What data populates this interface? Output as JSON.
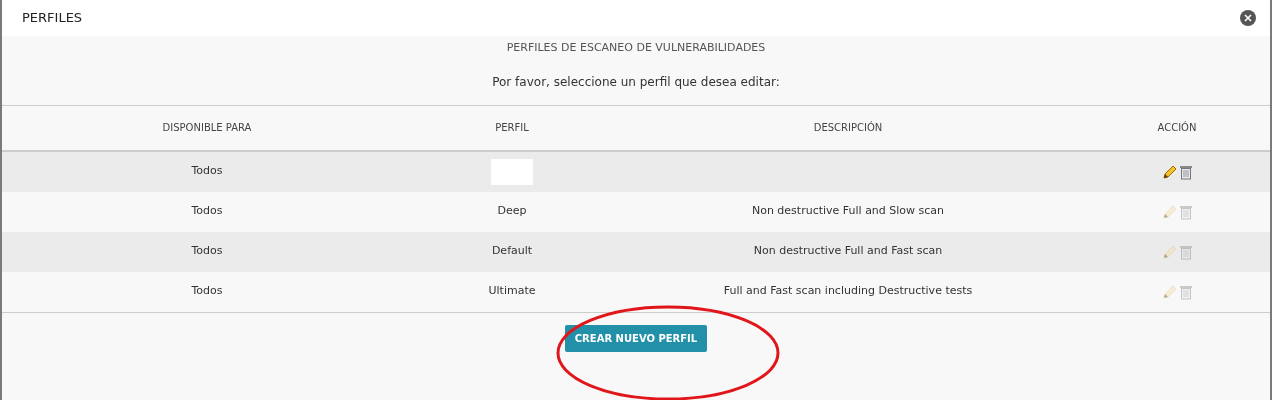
{
  "window": {
    "title": "PERFILES"
  },
  "heading": "PERFILES DE ESCANEO DE VULNERABILIDADES",
  "instruction": "Por favor, seleccione un perfil que desea editar:",
  "table": {
    "columns": [
      "DISPONIBLE PARA",
      "PERFIL",
      "DESCRIPCIÓN",
      "ACCIÓN"
    ],
    "rows": [
      {
        "available": "Todos",
        "redacted": true,
        "active": true
      },
      {
        "available": "Todos",
        "profile": "Deep",
        "description": "Non destructive Full and Slow scan",
        "redacted": false,
        "active": false
      },
      {
        "available": "Todos",
        "profile": "Default",
        "description": "Non destructive Full and Fast scan",
        "redacted": false,
        "active": false
      },
      {
        "available": "Todos",
        "profile": "Ultimate",
        "description": "Full and Fast scan including Destructive tests",
        "redacted": false,
        "active": false
      }
    ]
  },
  "create_button": "CREAR NUEVO PERFIL",
  "annotation": {
    "kind": "ellipse"
  }
}
